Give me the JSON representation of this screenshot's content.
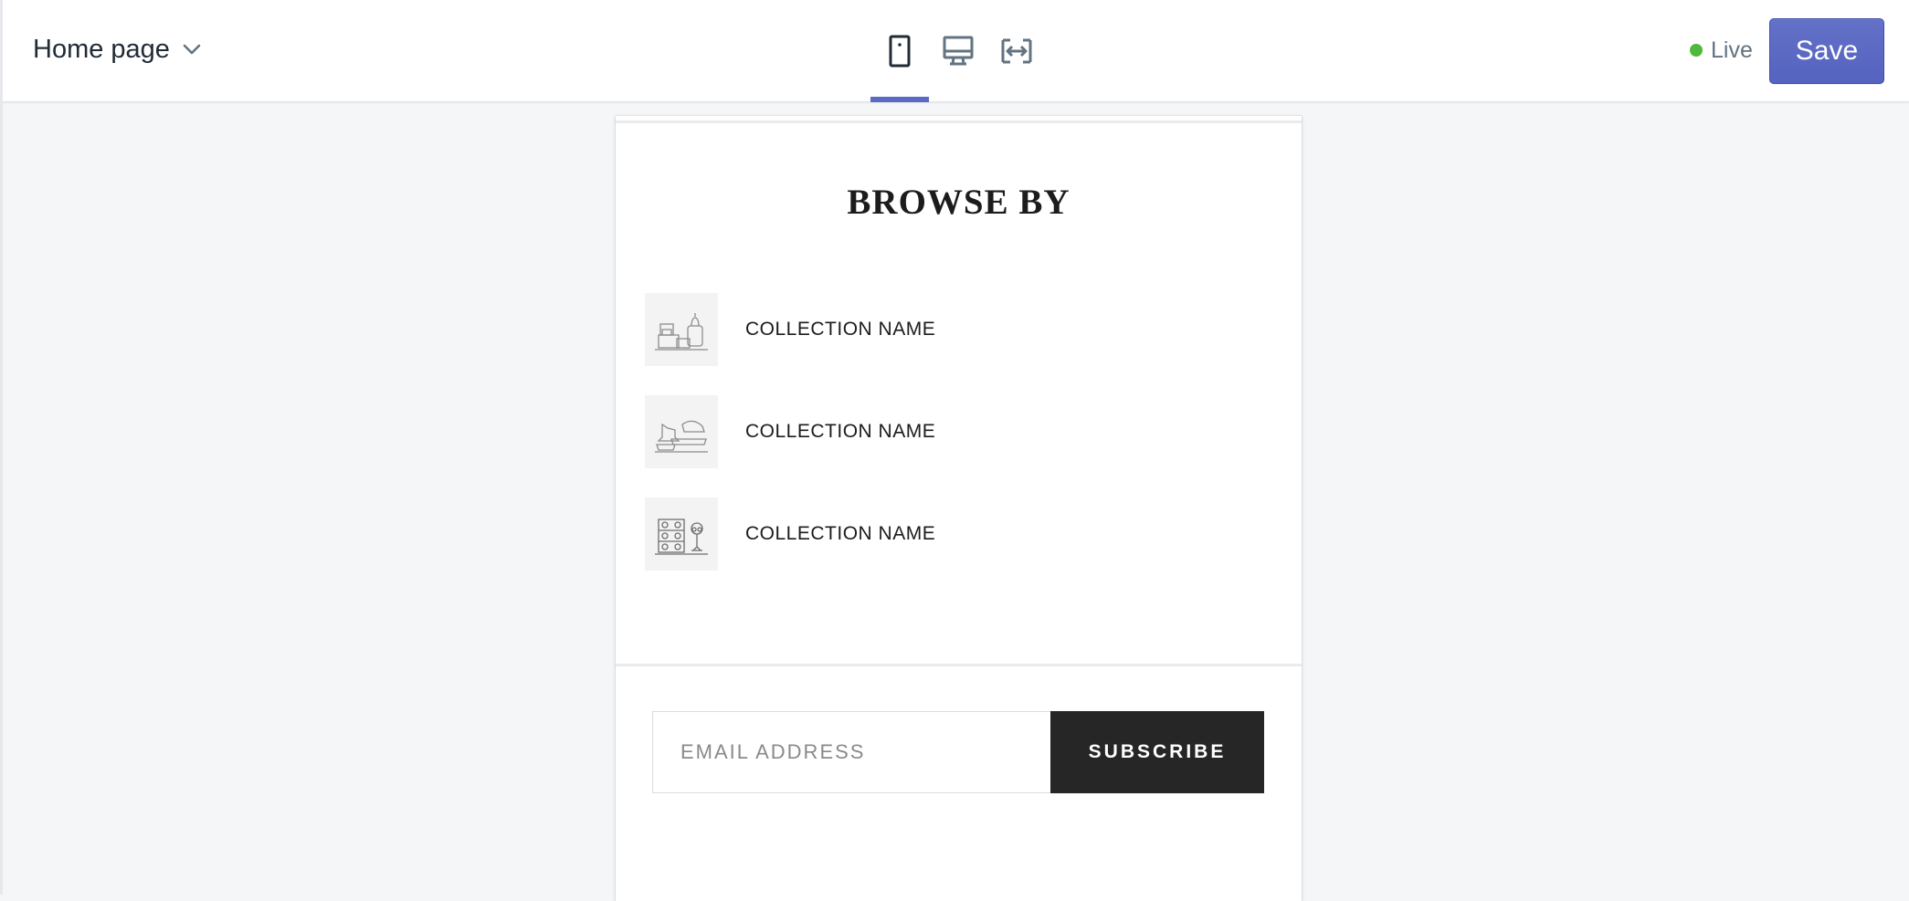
{
  "topbar": {
    "page_selector": {
      "label": "Home page",
      "icon": "chevron-down-icon"
    },
    "view_modes": [
      {
        "name": "mobile",
        "icon": "mobile-icon",
        "active": true
      },
      {
        "name": "desktop",
        "icon": "desktop-icon",
        "active": false
      },
      {
        "name": "full-width",
        "icon": "expand-horizontal-icon",
        "active": false
      }
    ],
    "status": {
      "label": "Live",
      "color": "#50b83c"
    },
    "save_label": "Save"
  },
  "preview": {
    "browse_title": "BROWSE BY",
    "collections": [
      {
        "label": "COLLECTION NAME",
        "icon": "bags-illustration-icon"
      },
      {
        "label": "COLLECTION NAME",
        "icon": "shoes-illustration-icon"
      },
      {
        "label": "COLLECTION NAME",
        "icon": "accessories-illustration-icon"
      }
    ],
    "newsletter": {
      "email_placeholder": "EMAIL ADDRESS",
      "email_value": "",
      "subscribe_label": "SUBSCRIBE"
    }
  },
  "colors": {
    "accent": "#5c6ac4",
    "save_button": "#5c6ac4",
    "canvas_background": "#f4f6f8",
    "subscribe_button": "#262626"
  }
}
